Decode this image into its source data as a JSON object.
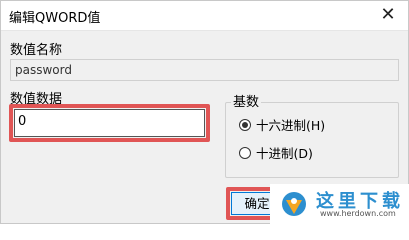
{
  "window": {
    "title": "编辑QWORD值",
    "close_label": "✕"
  },
  "value_name": {
    "label": "数值名称",
    "value": "password"
  },
  "value_data": {
    "label": "数值数据",
    "value": "0"
  },
  "base": {
    "label": "基数",
    "options": [
      {
        "label": "十六进制(H)",
        "selected": true
      },
      {
        "label": "十进制(D)",
        "selected": false
      }
    ]
  },
  "buttons": {
    "ok_label": "确定"
  },
  "watermark": {
    "title": "这里下载",
    "url": "www.herdown.com"
  },
  "colors": {
    "highlight": "#e05555",
    "accent": "#0078d7",
    "watermark": "#2d8fcf"
  }
}
